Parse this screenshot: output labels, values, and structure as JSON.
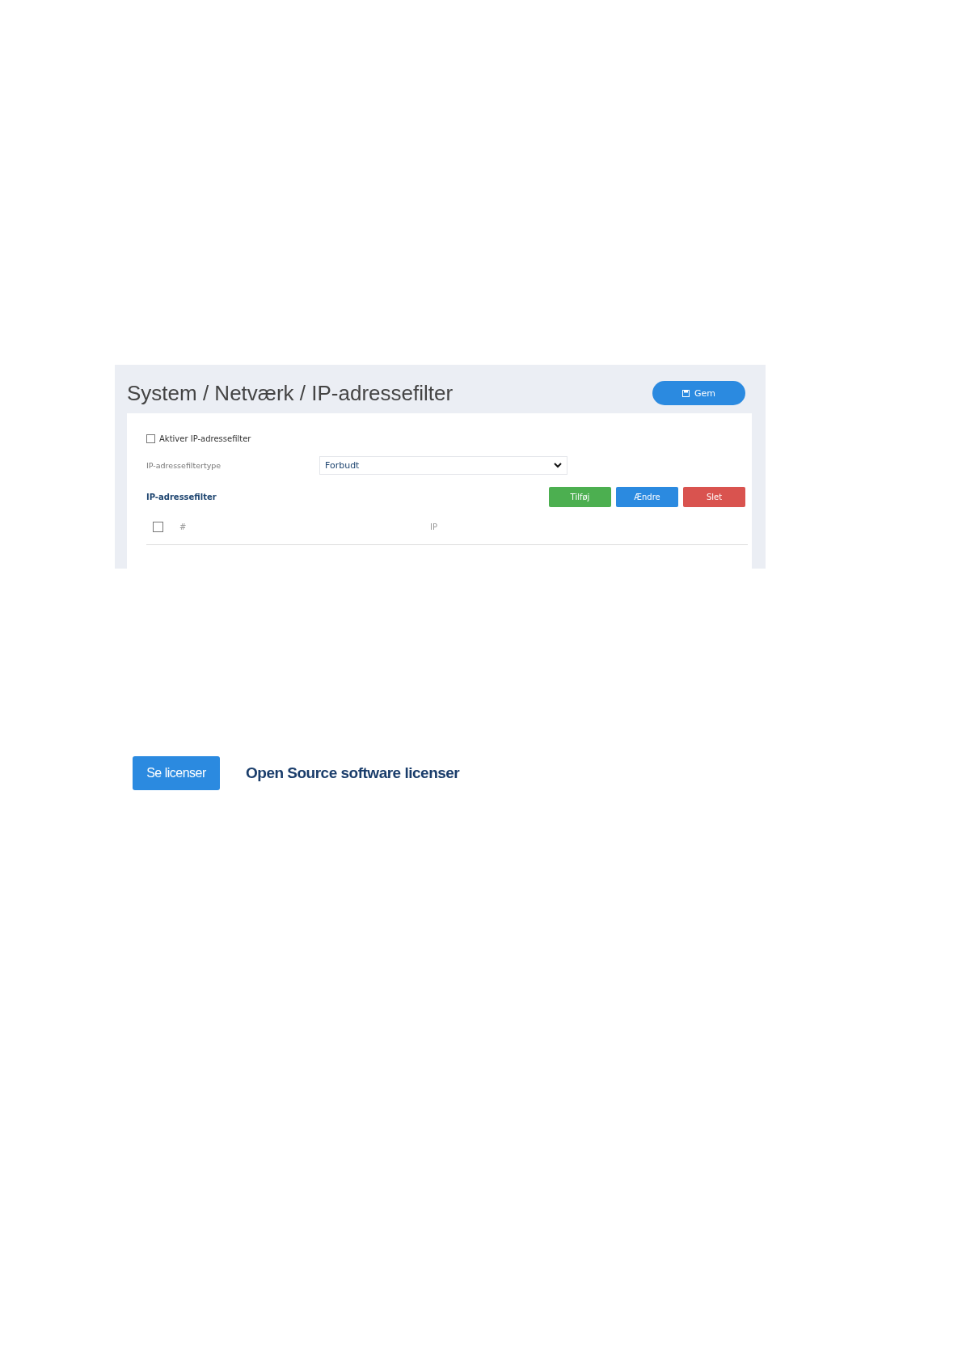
{
  "header": {
    "title": "System / Netværk / IP-adressefilter",
    "save_button": "Gem"
  },
  "settings": {
    "enable_checkbox": {
      "label": "Aktiver IP-adressefilter",
      "checked": false
    },
    "filter_type": {
      "label": "IP-adressefiltertype",
      "value": "Forbudt"
    }
  },
  "filter_list": {
    "title": "IP-adressefilter",
    "buttons": [
      {
        "label": "Tilføj",
        "kind": "add"
      },
      {
        "label": "Ændre",
        "kind": "edit"
      },
      {
        "label": "Slet",
        "kind": "delete"
      }
    ],
    "table": {
      "select_all_checked": false,
      "columns": [
        "#",
        "IP"
      ]
    }
  },
  "licenses": {
    "button": "Se licenser",
    "label": "Open Source software licenser"
  }
}
